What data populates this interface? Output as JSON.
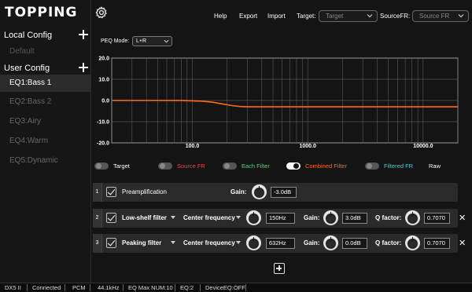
{
  "app": {
    "logo": "TOPPING",
    "gear_icon": "gear-icon"
  },
  "topbar": {
    "help": "Help",
    "export": "Export",
    "import": "Import",
    "target_label": "Target:",
    "target_value": "Target",
    "source_label": "SourceFR:",
    "source_value": "Source FR"
  },
  "sidebar": {
    "local_config": "Local Config",
    "local_items": [
      {
        "label": "Default"
      }
    ],
    "user_config": "User Config",
    "user_items": [
      {
        "label": "EQ1:Bass 1",
        "active": true
      },
      {
        "label": "EQ2:Bass 2",
        "active": false
      },
      {
        "label": "EQ3:Airy",
        "active": false
      },
      {
        "label": "EQ4:Warm",
        "active": false
      },
      {
        "label": "EQ5:Dynamic",
        "active": false
      }
    ]
  },
  "peq": {
    "mode_label": "PEQ Mode:",
    "mode_value": "L+R"
  },
  "chart_data": {
    "type": "line",
    "x_scale": "log",
    "xlim": [
      20,
      20000
    ],
    "ylim": [
      -20,
      20
    ],
    "y_ticks": [
      "20.0",
      "10.0",
      "0.0",
      "-10.0",
      "-20.0"
    ],
    "x_ticks": [
      "100.0",
      "1000.0",
      "10000.0"
    ],
    "grid": true,
    "series": [
      {
        "name": "Combined Filter",
        "color": "#ff6a1a",
        "x": [
          20,
          40,
          80,
          120,
          150,
          180,
          220,
          260,
          300,
          400,
          632,
          1000,
          5000,
          20000
        ],
        "y": [
          0,
          0,
          -0.05,
          -0.3,
          -0.8,
          -1.6,
          -2.4,
          -2.85,
          -3.0,
          -3.0,
          -3.0,
          -3.0,
          -3.0,
          -3.0
        ]
      }
    ]
  },
  "legend": [
    {
      "label": "Target",
      "color": "#ffffff",
      "on": false
    },
    {
      "label": "Source FR",
      "color": "#ff3b3b",
      "on": false
    },
    {
      "label": "Each Filter",
      "color": "#4cd964",
      "on": false
    },
    {
      "label": "Combined Filter",
      "color": "#ff6a1a",
      "on": true
    },
    {
      "label": "Filtered FR",
      "color": "#3fd0e0",
      "on": false
    },
    {
      "label": "Raw",
      "color": "#ffffff",
      "on": false
    }
  ],
  "filters": [
    {
      "num": "1",
      "name": "Preamplification",
      "gain_label": "Gain:",
      "gain": "-3.0dB"
    },
    {
      "num": "2",
      "type": "Low-shelf filter",
      "mode": "Center frequency",
      "freq": "150Hz",
      "gain_label": "Gain:",
      "gain": "3.0dB",
      "q_label": "Q factor:",
      "q": "0.7070",
      "del": "✕"
    },
    {
      "num": "3",
      "type": "Peaking filter",
      "mode": "Center frequency",
      "freq": "632Hz",
      "gain_label": "Gain:",
      "gain": "0.0dB",
      "q_label": "Q factor:",
      "q": "0.7070",
      "del": "✕"
    }
  ],
  "status": {
    "device": "DX5 II",
    "conn": "Connected",
    "format": "PCM",
    "rate": "44.1kHz",
    "max": "EQ Max NUM:10",
    "eq": "EQ:2",
    "device_eq": "DeviceEQ:OFF"
  }
}
